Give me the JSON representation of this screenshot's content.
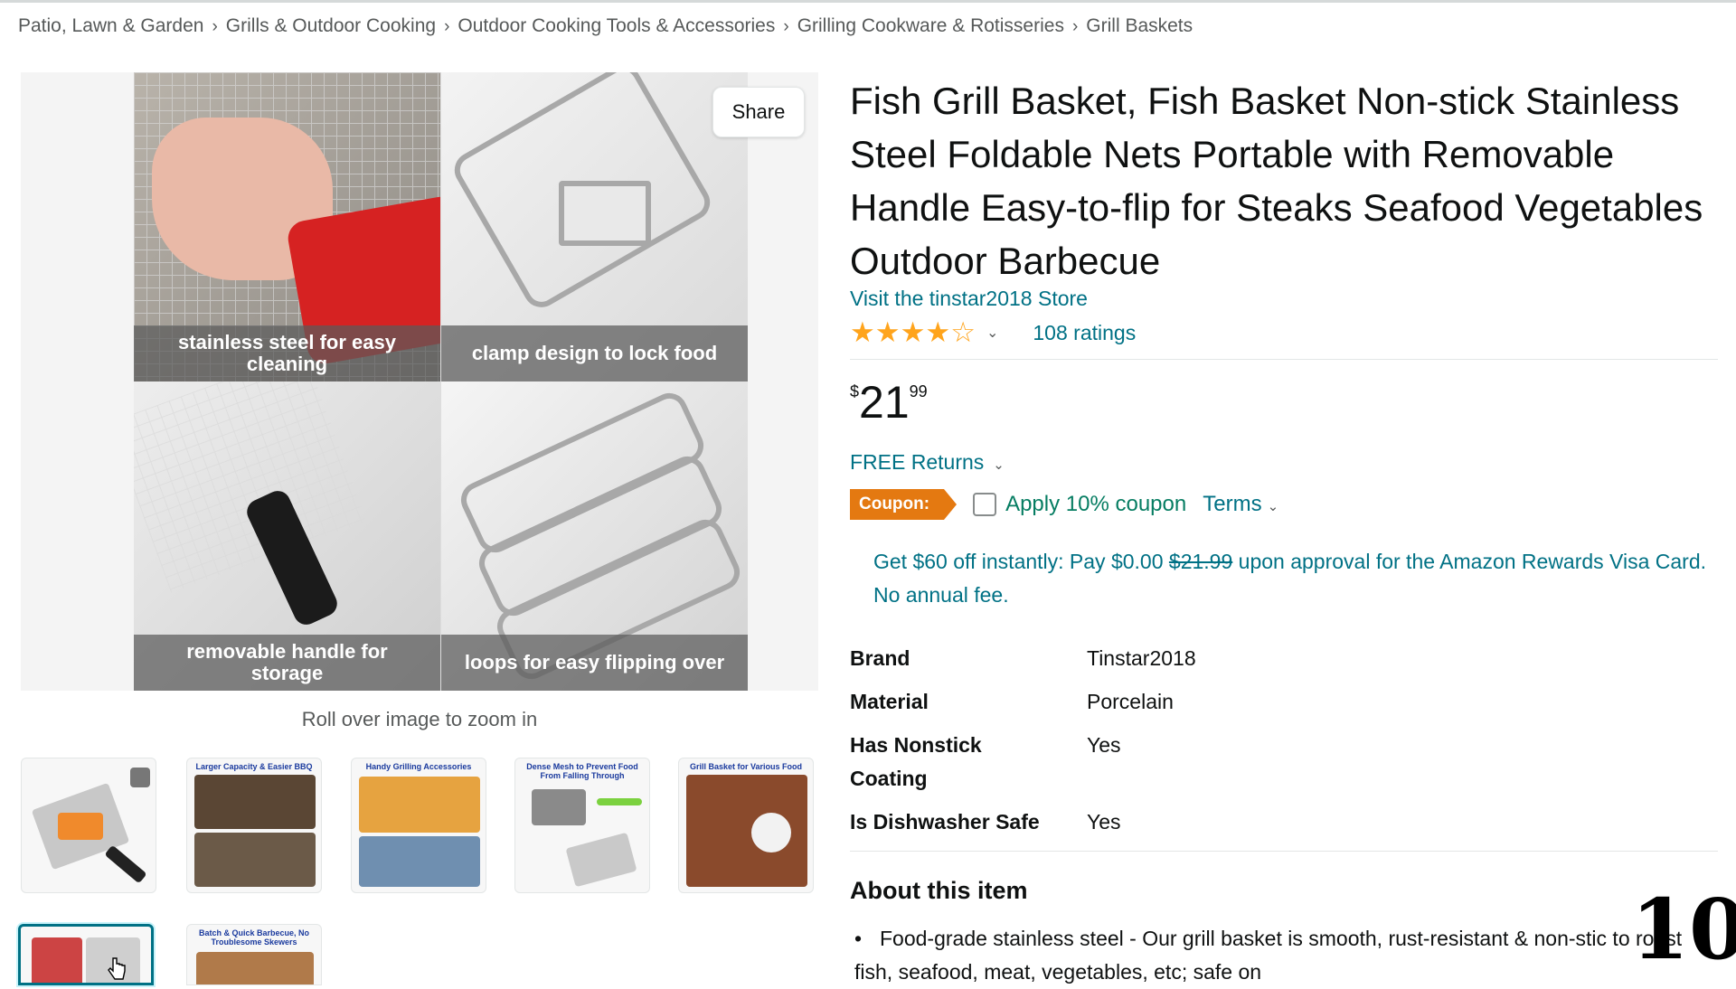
{
  "breadcrumb": {
    "items": [
      "Patio, Lawn & Garden",
      "Grills & Outdoor Cooking",
      "Outdoor Cooking Tools & Accessories",
      "Grilling Cookware & Rotisseries",
      "Grill Baskets"
    ],
    "separator": "›"
  },
  "gallery": {
    "share_label": "Share",
    "rollover_text": "Roll over image to zoom in",
    "captions": [
      "stainless steel for easy cleaning",
      "clamp design to lock food",
      "removable handle for storage",
      "loops for easy flipping over"
    ],
    "thumbnails": [
      {
        "label": ""
      },
      {
        "label": "Larger Capacity & Easier BBQ"
      },
      {
        "label": "Handy Grilling Accessories"
      },
      {
        "label": "Dense Mesh to Prevent Food From Falling Through"
      },
      {
        "label": "Grill Basket for Various Food"
      },
      {
        "label": ""
      },
      {
        "label": "Batch & Quick Barbecue, No Troublesome Skewers"
      }
    ]
  },
  "product": {
    "title": "Fish Grill Basket, Fish Basket Non-stick Stainless Steel Foldable Nets Portable with Removable Handle Easy-to-flip for Steaks Seafood Vegetables Outdoor Barbecue",
    "store_link": "Visit the tinstar2018 Store",
    "rating_value": 4.0,
    "ratings_count": "108 ratings",
    "price_symbol": "$",
    "price_whole": "21",
    "price_fraction": "99",
    "returns_label": "FREE Returns",
    "coupon_badge": "Coupon:",
    "coupon_text": "Apply 10% coupon",
    "terms_label": "Terms",
    "promo_prefix": "Get $60 off instantly: Pay $0.00 ",
    "promo_strike": "$21.99",
    "promo_suffix": " upon approval for the Amazon Rewards Visa Card. No annual fee."
  },
  "specs": [
    {
      "key": "Brand",
      "value": "Tinstar2018"
    },
    {
      "key": "Material",
      "value": "Porcelain"
    },
    {
      "key": "Has Nonstick Coating",
      "value": "Yes"
    },
    {
      "key": "Is Dishwasher Safe",
      "value": "Yes"
    }
  ],
  "about": {
    "title": "About this item",
    "first_item": "Food-grade stainless steel - Our grill basket is smooth, rust-resistant & non-stic to roast fish, seafood, meat, vegetables, etc; safe on"
  },
  "overlay_number": "10",
  "colors": {
    "link": "#007185",
    "star": "#ffa41c",
    "coupon_badge": "#e47911",
    "coupon_text": "#067d62",
    "text": "#0f1111",
    "muted": "#565959"
  },
  "icons": [
    "star-icon",
    "chevron-down-icon",
    "cursor-hand-icon"
  ]
}
